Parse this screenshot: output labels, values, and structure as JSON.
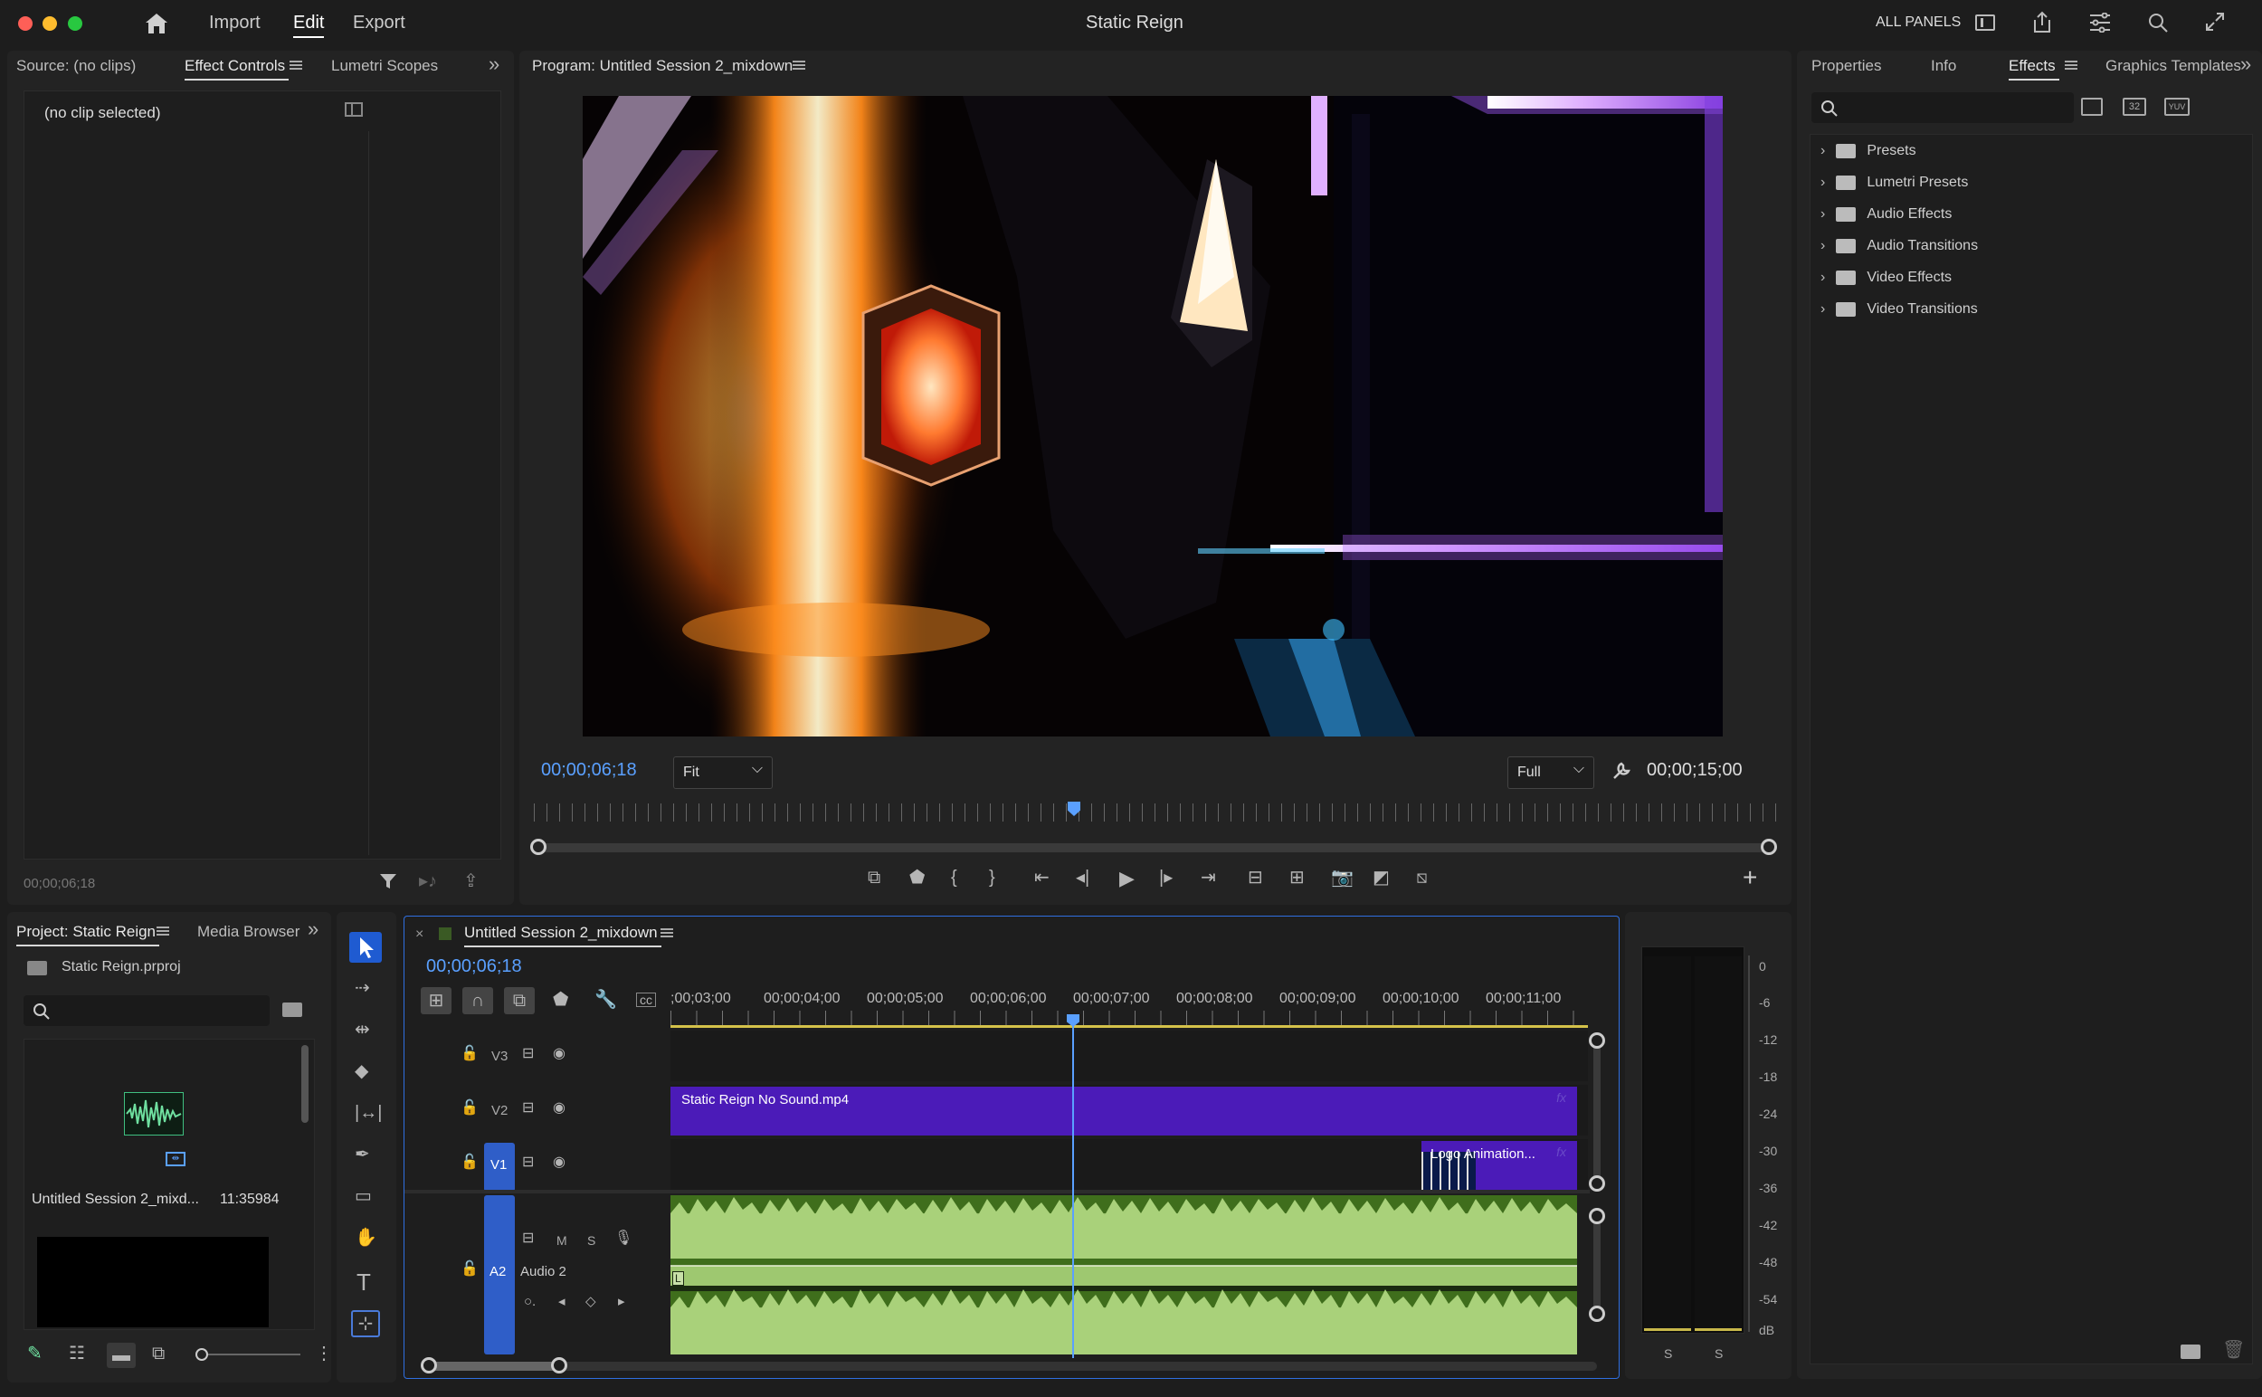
{
  "app": {
    "title": "Static Reign",
    "nav": [
      "Import",
      "Edit",
      "Export"
    ],
    "active_nav": "Edit",
    "all_panels": "ALL PANELS"
  },
  "source_panel": {
    "tabs": [
      "Source: (no clips)",
      "Effect Controls",
      "Lumetri Scopes"
    ],
    "active_tab": "Effect Controls",
    "no_clip": "(no clip selected)",
    "timecode": "00;00;06;18"
  },
  "program": {
    "title": "Program: Untitled Session 2_mixdown",
    "timecode": "00;00;06;18",
    "fit": "Fit",
    "quality": "Full",
    "duration": "00;00;15;00"
  },
  "effects_panel": {
    "tabs": [
      "Properties",
      "Info",
      "Effects",
      "Graphics Templates"
    ],
    "active_tab": "Effects",
    "search_placeholder": "",
    "badges": [
      "32",
      "YUV"
    ],
    "items": [
      "Presets",
      "Lumetri Presets",
      "Audio Effects",
      "Audio Transitions",
      "Video Effects",
      "Video Transitions"
    ]
  },
  "project": {
    "tabs": [
      "Project: Static Reign",
      "Media Browser"
    ],
    "file": "Static Reign.prproj",
    "clip_name": "Untitled Session 2_mixd...",
    "clip_duration": "11:35984"
  },
  "timeline": {
    "title": "Untitled Session 2_mixdown",
    "timecode": "00;00;06;18",
    "ruler": [
      ";00;03;00",
      "00;00;04;00",
      "00;00;05;00",
      "00;00;06;00",
      "00;00;07;00",
      "00;00;08;00",
      "00;00;09;00",
      "00;00;10;00",
      "00;00;11;00"
    ],
    "tracks": {
      "v3": "V3",
      "v2": "V2",
      "v1": "V1",
      "a2": "A2",
      "a2_name": "Audio 2",
      "a2_m": "M",
      "a2_s": "S"
    },
    "clips": {
      "v2": "Static Reign No Sound.mp4",
      "v1": "Logo Animation...",
      "fx": "fx",
      "audio_L": "L"
    }
  },
  "meter": {
    "db_labels": [
      "0",
      "-6",
      "-12",
      "-18",
      "-24",
      "-30",
      "-36",
      "-42",
      "-48",
      "-54",
      "dB"
    ],
    "solo": [
      "S",
      "S"
    ]
  },
  "colors": {
    "accent": "#2f6fe0",
    "timecode": "#5aa0ff",
    "video_clip": "#4b1bb8",
    "audio_clip": "#3f6e1c",
    "waveform": "#a9d17a"
  }
}
